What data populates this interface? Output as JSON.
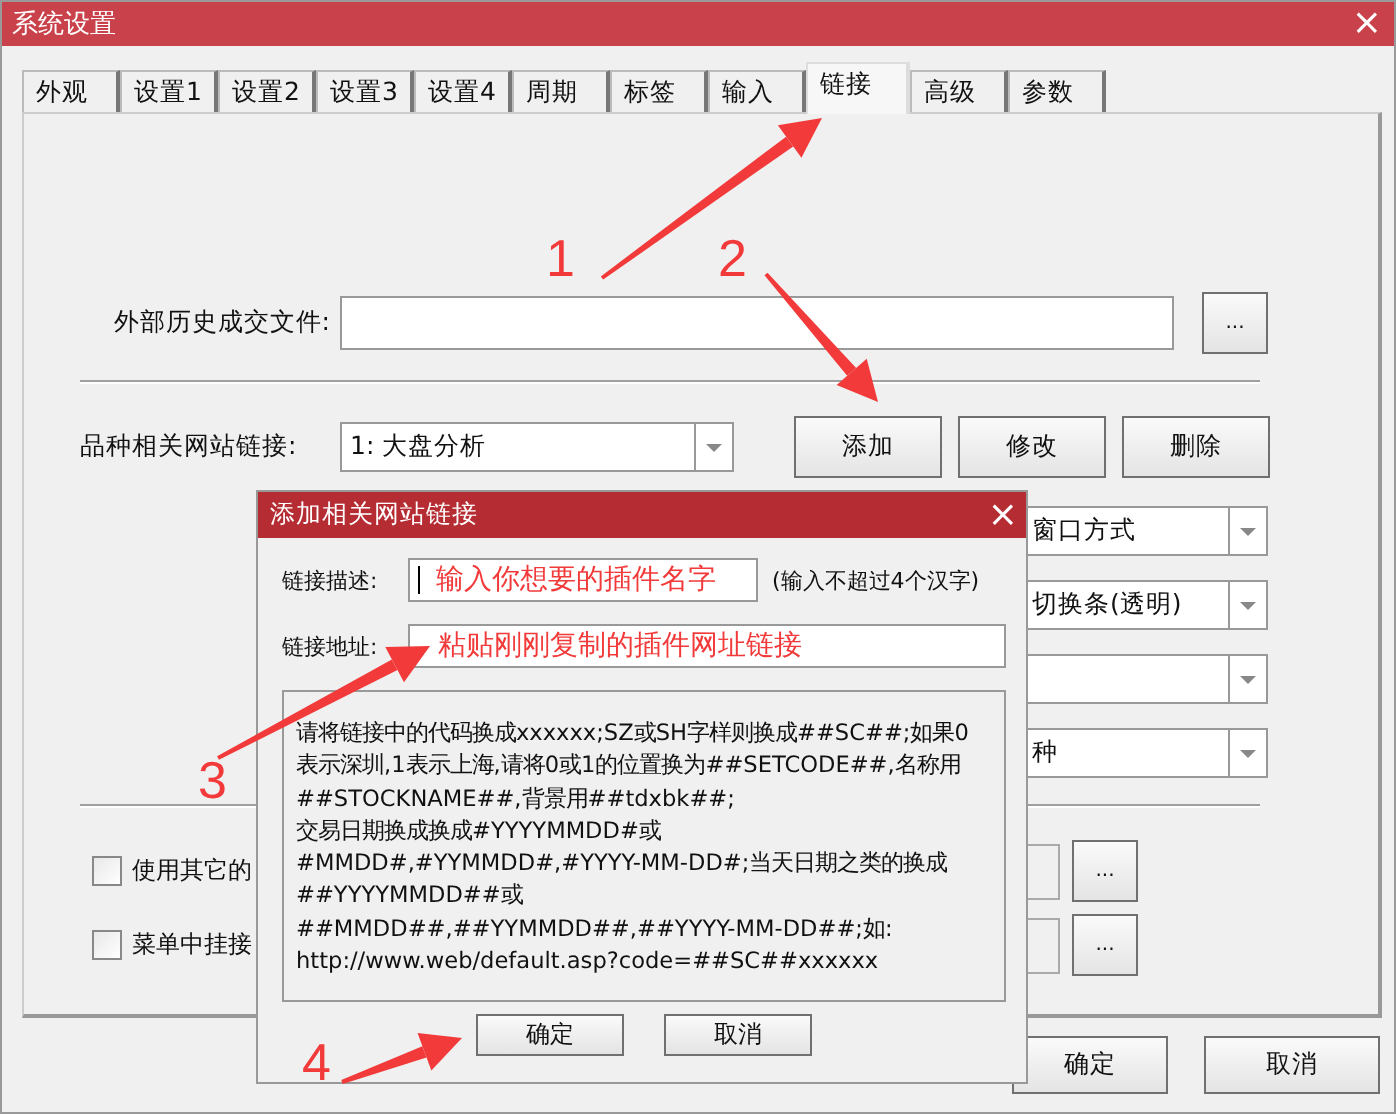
{
  "window": {
    "title": "系统设置",
    "close": "×"
  },
  "tabs": [
    {
      "label": "外观",
      "selected": false
    },
    {
      "label": "设置1",
      "selected": false
    },
    {
      "label": "设置2",
      "selected": false
    },
    {
      "label": "设置3",
      "selected": false
    },
    {
      "label": "设置4",
      "selected": false
    },
    {
      "label": "周期",
      "selected": false
    },
    {
      "label": "标签",
      "selected": false
    },
    {
      "label": "输入",
      "selected": false
    },
    {
      "label": "链接",
      "selected": true
    },
    {
      "label": "高级",
      "selected": false
    },
    {
      "label": "参数",
      "selected": false
    }
  ],
  "history_file": {
    "label": "外部历史成交文件:",
    "browse": "..."
  },
  "site_link": {
    "label": "品种相关网站链接:",
    "value": "1: 大盘分析",
    "buttons": [
      "添加",
      "修改",
      "删除"
    ]
  },
  "dropdowns": [
    {
      "kind": "dropdown",
      "value": "窗口方式"
    },
    {
      "kind": "dropdown",
      "value": "切换条(透明)"
    },
    {
      "kind": "dropdown"
    },
    {
      "kind": "dropdown",
      "value": "种"
    }
  ],
  "options": [
    {
      "label": "使用其它的",
      "checked": false,
      "browse": "..."
    },
    {
      "label": "菜单中挂接",
      "checked": false,
      "browse": "..."
    }
  ],
  "buttons": [
    "确定",
    "取消"
  ],
  "add_link_dialog": {
    "title": "添加相关网站链接",
    "close": "×",
    "fields": [
      {
        "label": "链接描述:",
        "value": "输入你想要的插件名字",
        "hint": "(输入不超过4个汉字)"
      },
      {
        "label": "链接地址:",
        "value": "粘贴刚刚复制的插件网址链接"
      }
    ],
    "info_lines": [
      "请将链接中的代码换成xxxxxx;SZ或SH字样则换成##SC##;如果0",
      "表示深圳,1表示上海,请将0或1的位置换为##SETCODE##,名称用",
      "##STOCKNAME##,背景用##tdxbk##;",
      "交易日期换成换成#YYYYMMDD#或",
      "#MMDD#,#YYMMDD#,#YYYY-MM-DD#;当天日期之类的换成",
      "##YYYYMMDD##或",
      "##MMDD##,##YYMMDD##,##YYYY-MM-DD##;如:",
      "http://www.web/default.asp?code=##SC##xxxxxx"
    ],
    "buttons": [
      "确定",
      "取消"
    ]
  },
  "annotations": [
    {
      "label": "1"
    },
    {
      "label": "2"
    },
    {
      "label": "3"
    },
    {
      "label": "4"
    }
  ]
}
